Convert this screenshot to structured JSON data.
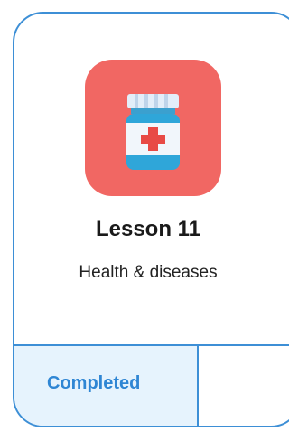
{
  "lesson": {
    "title": "Lesson 11",
    "subtitle": "Health & diseases",
    "icon": "medicine-bottle-icon",
    "status": "Completed"
  },
  "colors": {
    "card_border": "#3d8fd6",
    "icon_background": "#f16763",
    "status_background": "#e6f3fd",
    "status_text": "#2f86d4"
  }
}
